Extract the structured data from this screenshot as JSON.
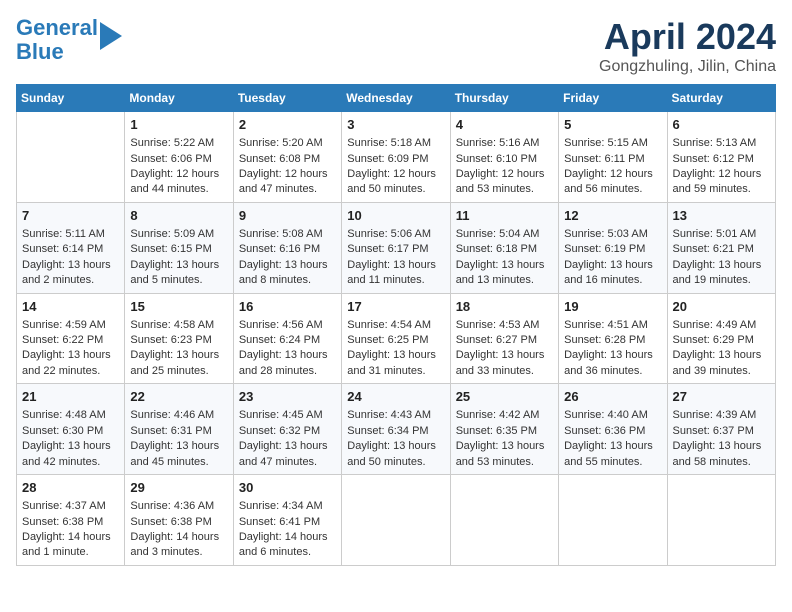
{
  "header": {
    "logo_line1": "General",
    "logo_line2": "Blue",
    "title": "April 2024",
    "subtitle": "Gongzhuling, Jilin, China"
  },
  "weekdays": [
    "Sunday",
    "Monday",
    "Tuesday",
    "Wednesday",
    "Thursday",
    "Friday",
    "Saturday"
  ],
  "weeks": [
    [
      {
        "day": "",
        "info": ""
      },
      {
        "day": "1",
        "info": "Sunrise: 5:22 AM\nSunset: 6:06 PM\nDaylight: 12 hours\nand 44 minutes."
      },
      {
        "day": "2",
        "info": "Sunrise: 5:20 AM\nSunset: 6:08 PM\nDaylight: 12 hours\nand 47 minutes."
      },
      {
        "day": "3",
        "info": "Sunrise: 5:18 AM\nSunset: 6:09 PM\nDaylight: 12 hours\nand 50 minutes."
      },
      {
        "day": "4",
        "info": "Sunrise: 5:16 AM\nSunset: 6:10 PM\nDaylight: 12 hours\nand 53 minutes."
      },
      {
        "day": "5",
        "info": "Sunrise: 5:15 AM\nSunset: 6:11 PM\nDaylight: 12 hours\nand 56 minutes."
      },
      {
        "day": "6",
        "info": "Sunrise: 5:13 AM\nSunset: 6:12 PM\nDaylight: 12 hours\nand 59 minutes."
      }
    ],
    [
      {
        "day": "7",
        "info": "Sunrise: 5:11 AM\nSunset: 6:14 PM\nDaylight: 13 hours\nand 2 minutes."
      },
      {
        "day": "8",
        "info": "Sunrise: 5:09 AM\nSunset: 6:15 PM\nDaylight: 13 hours\nand 5 minutes."
      },
      {
        "day": "9",
        "info": "Sunrise: 5:08 AM\nSunset: 6:16 PM\nDaylight: 13 hours\nand 8 minutes."
      },
      {
        "day": "10",
        "info": "Sunrise: 5:06 AM\nSunset: 6:17 PM\nDaylight: 13 hours\nand 11 minutes."
      },
      {
        "day": "11",
        "info": "Sunrise: 5:04 AM\nSunset: 6:18 PM\nDaylight: 13 hours\nand 13 minutes."
      },
      {
        "day": "12",
        "info": "Sunrise: 5:03 AM\nSunset: 6:19 PM\nDaylight: 13 hours\nand 16 minutes."
      },
      {
        "day": "13",
        "info": "Sunrise: 5:01 AM\nSunset: 6:21 PM\nDaylight: 13 hours\nand 19 minutes."
      }
    ],
    [
      {
        "day": "14",
        "info": "Sunrise: 4:59 AM\nSunset: 6:22 PM\nDaylight: 13 hours\nand 22 minutes."
      },
      {
        "day": "15",
        "info": "Sunrise: 4:58 AM\nSunset: 6:23 PM\nDaylight: 13 hours\nand 25 minutes."
      },
      {
        "day": "16",
        "info": "Sunrise: 4:56 AM\nSunset: 6:24 PM\nDaylight: 13 hours\nand 28 minutes."
      },
      {
        "day": "17",
        "info": "Sunrise: 4:54 AM\nSunset: 6:25 PM\nDaylight: 13 hours\nand 31 minutes."
      },
      {
        "day": "18",
        "info": "Sunrise: 4:53 AM\nSunset: 6:27 PM\nDaylight: 13 hours\nand 33 minutes."
      },
      {
        "day": "19",
        "info": "Sunrise: 4:51 AM\nSunset: 6:28 PM\nDaylight: 13 hours\nand 36 minutes."
      },
      {
        "day": "20",
        "info": "Sunrise: 4:49 AM\nSunset: 6:29 PM\nDaylight: 13 hours\nand 39 minutes."
      }
    ],
    [
      {
        "day": "21",
        "info": "Sunrise: 4:48 AM\nSunset: 6:30 PM\nDaylight: 13 hours\nand 42 minutes."
      },
      {
        "day": "22",
        "info": "Sunrise: 4:46 AM\nSunset: 6:31 PM\nDaylight: 13 hours\nand 45 minutes."
      },
      {
        "day": "23",
        "info": "Sunrise: 4:45 AM\nSunset: 6:32 PM\nDaylight: 13 hours\nand 47 minutes."
      },
      {
        "day": "24",
        "info": "Sunrise: 4:43 AM\nSunset: 6:34 PM\nDaylight: 13 hours\nand 50 minutes."
      },
      {
        "day": "25",
        "info": "Sunrise: 4:42 AM\nSunset: 6:35 PM\nDaylight: 13 hours\nand 53 minutes."
      },
      {
        "day": "26",
        "info": "Sunrise: 4:40 AM\nSunset: 6:36 PM\nDaylight: 13 hours\nand 55 minutes."
      },
      {
        "day": "27",
        "info": "Sunrise: 4:39 AM\nSunset: 6:37 PM\nDaylight: 13 hours\nand 58 minutes."
      }
    ],
    [
      {
        "day": "28",
        "info": "Sunrise: 4:37 AM\nSunset: 6:38 PM\nDaylight: 14 hours\nand 1 minute."
      },
      {
        "day": "29",
        "info": "Sunrise: 4:36 AM\nSunset: 6:38 PM\nDaylight: 14 hours\nand 3 minutes."
      },
      {
        "day": "30",
        "info": "Sunrise: 4:34 AM\nSunset: 6:41 PM\nDaylight: 14 hours\nand 6 minutes."
      },
      {
        "day": "",
        "info": ""
      },
      {
        "day": "",
        "info": ""
      },
      {
        "day": "",
        "info": ""
      },
      {
        "day": "",
        "info": ""
      }
    ]
  ]
}
